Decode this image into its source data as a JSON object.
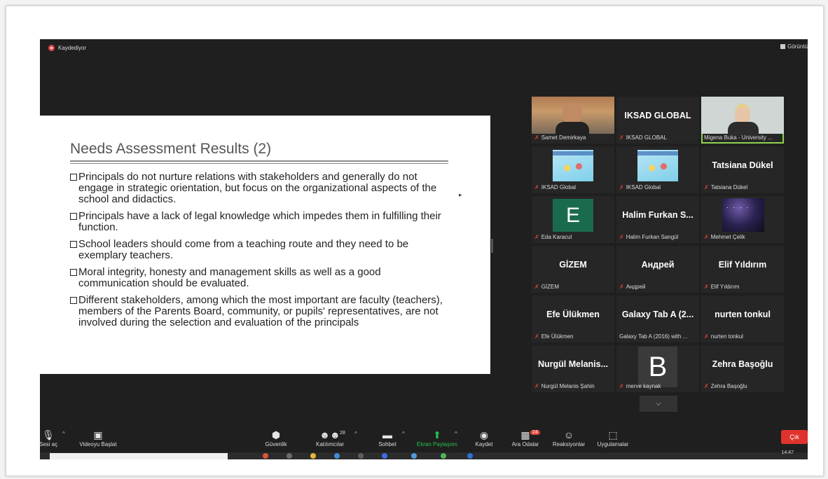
{
  "zoom": {
    "recording_label": "Kaydediyor",
    "view_label": "Görüntü",
    "colors": {
      "background": "#1f1f1f",
      "mute": "#e0423a",
      "share": "#28c24a",
      "leave": "#e0332d",
      "active_speaker": "#8fd14f"
    }
  },
  "slide": {
    "title": "Needs Assessment Results (2)",
    "bullets": [
      "Principals do not nurture relations with stakeholders and generally do not engage in strategic orientation, but focus on the organizational aspects of the school and didactics.",
      "Principals have a lack of legal knowledge which impedes them in fulfilling their function.",
      "School leaders should come from a teaching route and they need to be exemplary teachers.",
      "Moral integrity, honesty and management skills as well as a good communication should be evaluated.",
      "Different stakeholders, among which the most important are faculty (teachers), members of the Parents Board, community, or pupils' representatives, are not involved during the selection and evaluation of the principals"
    ]
  },
  "participants": [
    {
      "display": "",
      "label": "Samet Demirkaya",
      "kind": "video-man"
    },
    {
      "display": "IKSAD GLOBAL",
      "label": "IKSAD GLOBAL",
      "kind": "name"
    },
    {
      "display": "",
      "label": "Migena Buka - University ...",
      "kind": "video-woman"
    },
    {
      "display": "",
      "label": "IKSAD Global",
      "kind": "poster"
    },
    {
      "display": "",
      "label": "IKSAD Global",
      "kind": "poster"
    },
    {
      "display": "Tatsiana Dükel",
      "label": "Tatsiana Dükel",
      "kind": "name"
    },
    {
      "display": "E",
      "label": "Eda Karacul",
      "kind": "avatar-e"
    },
    {
      "display": "Halim Furkan S...",
      "label": "Halim Furkan Sangül",
      "kind": "name"
    },
    {
      "display": "",
      "label": "Mehmet Çelik",
      "kind": "galaxy"
    },
    {
      "display": "GİZEM",
      "label": "GİZEM",
      "kind": "name"
    },
    {
      "display": "Андрей",
      "label": "Андрей",
      "kind": "name"
    },
    {
      "display": "Elif Yıldırım",
      "label": "Elif Yıldırım",
      "kind": "name"
    },
    {
      "display": "Efe Ülükmen",
      "label": "Efe Ülükmen",
      "kind": "name"
    },
    {
      "display": "Galaxy Tab A (2...",
      "label": "Galaxy Tab A (2016) with ...",
      "kind": "name"
    },
    {
      "display": "nurten tonkul",
      "label": "nurten tonkul",
      "kind": "name"
    },
    {
      "display": "Nurgül Melanis...",
      "label": "Nurgül Melanis Şahin",
      "kind": "name"
    },
    {
      "display": "B",
      "label": "merve kaynak",
      "kind": "avatar-b"
    },
    {
      "display": "Zehra Başoğlu",
      "label": "Zehra Başoğlu",
      "kind": "name"
    }
  ],
  "toolbar": {
    "audio": "Sesi aç",
    "video": "Videoyu Başlat",
    "security": "Güvenlik",
    "participants": "Katılımcılar",
    "participants_count": "28",
    "chat": "Sohbet",
    "share": "Ekran Paylaşımı",
    "record": "Kaydet",
    "breakout": "Ara Odalar",
    "breakout_badge": "24",
    "reactions": "Reaksiyonlar",
    "apps": "Uygulamalar",
    "leave": "Çık"
  },
  "taskbar": {
    "clock": "14:47"
  }
}
